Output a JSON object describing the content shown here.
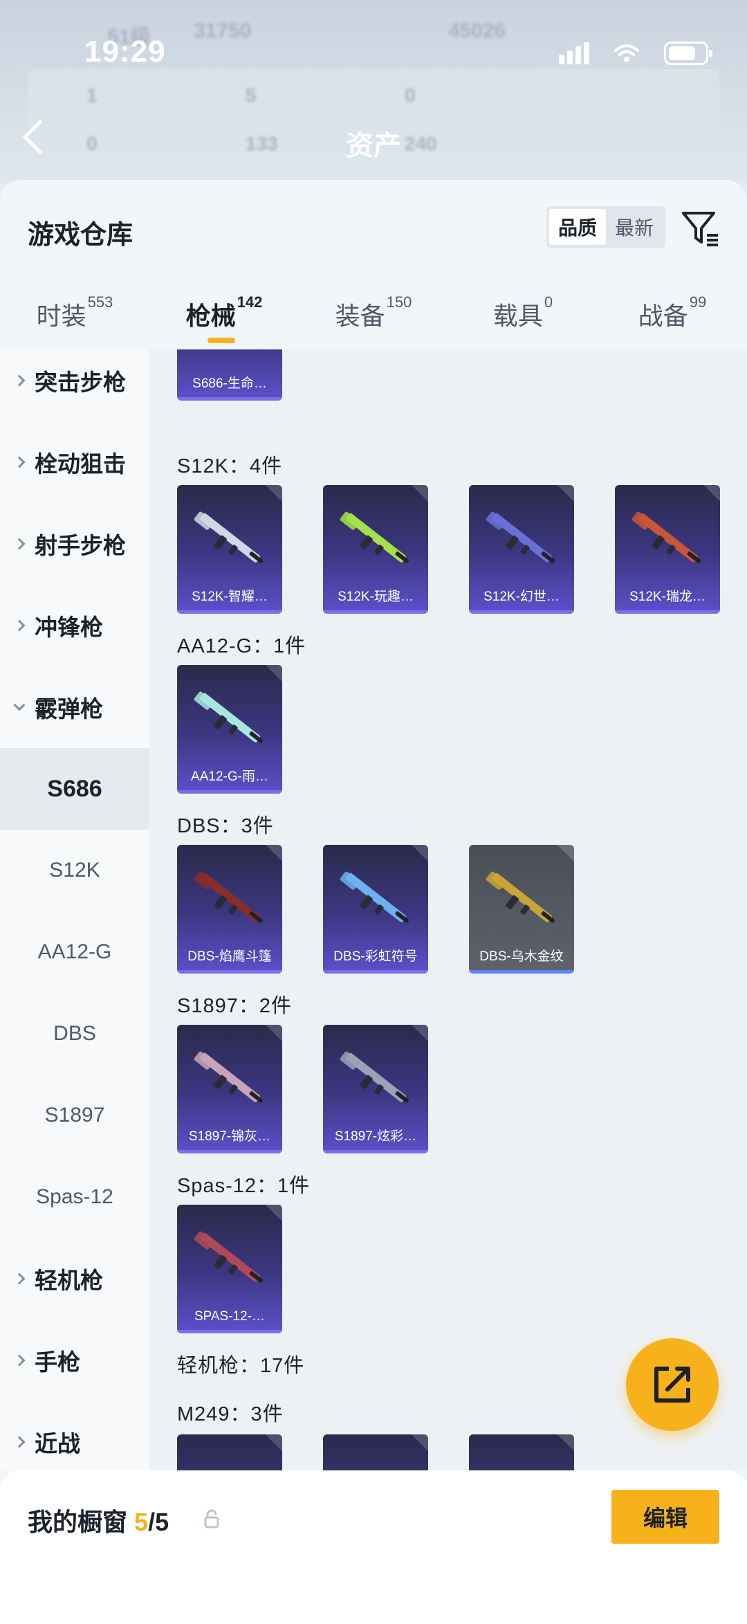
{
  "status_bar": {
    "time": "19:29"
  },
  "background_header": {
    "title": "资产",
    "blurred_texts": [
      "51级",
      "31750",
      "45026",
      "1",
      "5",
      "0",
      "0",
      "133",
      "240"
    ]
  },
  "sheet": {
    "title": "游戏仓库",
    "sort": {
      "options": [
        "品质",
        "最新"
      ],
      "active_index": 0
    },
    "filter_icon": "filter-icon"
  },
  "tabs": [
    {
      "label": "时装",
      "count": "553"
    },
    {
      "label": "枪械",
      "count": "142",
      "active": true
    },
    {
      "label": "装备",
      "count": "150"
    },
    {
      "label": "载具",
      "count": "0"
    },
    {
      "label": "战备",
      "count": "99"
    }
  ],
  "sidenav": [
    {
      "label": "突击步枪",
      "type": "group"
    },
    {
      "label": "栓动狙击",
      "type": "group"
    },
    {
      "label": "射手步枪",
      "type": "group"
    },
    {
      "label": "冲锋枪",
      "type": "group"
    },
    {
      "label": "霰弹枪",
      "type": "group",
      "open": true
    },
    {
      "label": "S686",
      "type": "sub",
      "active": true
    },
    {
      "label": "S12K",
      "type": "sub"
    },
    {
      "label": "AA12-G",
      "type": "sub"
    },
    {
      "label": "DBS",
      "type": "sub"
    },
    {
      "label": "S1897",
      "type": "sub"
    },
    {
      "label": "Spas-12",
      "type": "sub"
    },
    {
      "label": "轻机枪",
      "type": "group"
    },
    {
      "label": "手枪",
      "type": "group"
    },
    {
      "label": "近战",
      "type": "group"
    }
  ],
  "content": {
    "s686_cards": [
      {
        "name": "S686-生命…",
        "color": "#7a2a2a"
      }
    ],
    "s12k_label": "S12K：4件",
    "s12k_cards": [
      {
        "name": "S12K-智耀…",
        "color": "#cfd8e6"
      },
      {
        "name": "S12K-玩趣…",
        "color": "#a6e04a"
      },
      {
        "name": "S12K-幻世…",
        "color": "#6a6fd6"
      },
      {
        "name": "S12K-瑞龙…",
        "color": "#c9553b"
      }
    ],
    "aa12_label": "AA12-G：1件",
    "aa12_cards": [
      {
        "name": "AA12-G-雨…",
        "color": "#a8e6e0"
      }
    ],
    "dbs_label": "DBS：3件",
    "dbs_cards": [
      {
        "name": "DBS-焰鹰斗篷",
        "color": "#8a2d2d"
      },
      {
        "name": "DBS-彩虹符号",
        "color": "#6fb0f0"
      },
      {
        "name": "DBS-乌木金纹",
        "color": "#c9a436"
      }
    ],
    "s1897_label": "S1897：2件",
    "s1897_cards": [
      {
        "name": "S1897-锦灰…",
        "color": "#c9a3b8"
      },
      {
        "name": "S1897-炫彩…",
        "color": "#9aa3b5"
      }
    ],
    "spas_label": "Spas-12：1件",
    "spas_cards": [
      {
        "name": "SPAS-12-…",
        "color": "#b04a5a"
      }
    ],
    "lmg_label": "轻机枪：17件",
    "m249_label": "M249：3件"
  },
  "bottom_bar": {
    "showcase_label": "我的橱窗",
    "showcase_count": "5",
    "showcase_total": "/5",
    "edit_label": "编辑"
  },
  "colors": {
    "accent": "#f7b21b",
    "card_purple": "#3c3782",
    "card_border": "#7b6ee8"
  }
}
